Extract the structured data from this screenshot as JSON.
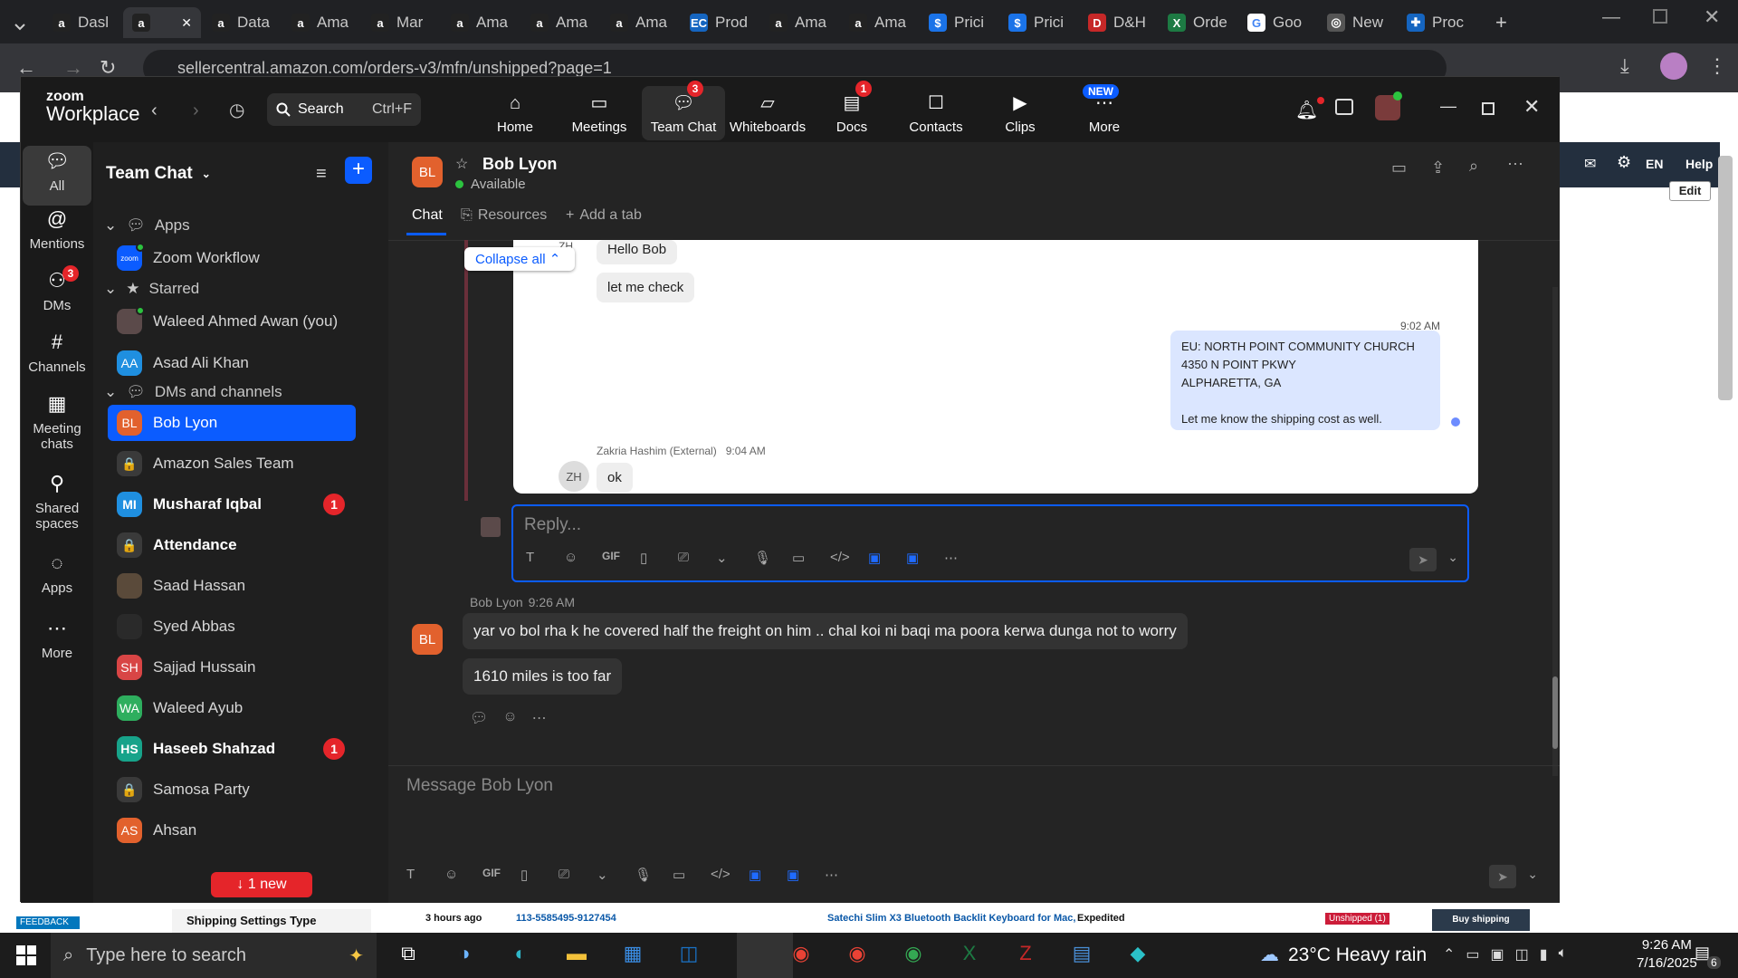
{
  "browser": {
    "tabs": [
      {
        "label": "Dasl",
        "fav": "a",
        "color": "#222"
      },
      {
        "label": "",
        "fav": "a",
        "color": "#222",
        "active": true
      },
      {
        "label": "Data",
        "fav": "a",
        "color": "#222"
      },
      {
        "label": "Ama",
        "fav": "a",
        "color": "#222"
      },
      {
        "label": "Mar",
        "fav": "a",
        "color": "#222"
      },
      {
        "label": "Ama",
        "fav": "a",
        "color": "#222"
      },
      {
        "label": "Ama",
        "fav": "a",
        "color": "#222"
      },
      {
        "label": "Ama",
        "fav": "a",
        "color": "#222"
      },
      {
        "label": "Prod",
        "fav": "EC",
        "color": "#1565c0"
      },
      {
        "label": "Ama",
        "fav": "a",
        "color": "#222"
      },
      {
        "label": "Ama",
        "fav": "a",
        "color": "#222"
      },
      {
        "label": "Prici",
        "fav": "$",
        "color": "#1a73e8"
      },
      {
        "label": "Prici",
        "fav": "$",
        "color": "#1a73e8"
      },
      {
        "label": "D&H",
        "fav": "D",
        "color": "#c62828"
      },
      {
        "label": "Orde",
        "fav": "X",
        "color": "#1d7a43"
      },
      {
        "label": "Goo",
        "fav": "G",
        "color": "#ffffff"
      },
      {
        "label": "New",
        "fav": "◎",
        "color": "#555"
      },
      {
        "label": "Proc",
        "fav": "✚",
        "color": "#1565c0"
      }
    ],
    "url": "sellercentral.amazon.com/orders-v3/mfn/unshipped?page=1"
  },
  "bg_page": {
    "lang": "EN",
    "help": "Help",
    "edit": "Edit",
    "feedback": "FEEDBACK",
    "shipping_settings": "Shipping Settings Type",
    "order_time": "3 hours ago",
    "order_id": "113-5585495-9127454",
    "product": "Satechi Slim X3 Bluetooth Backlit Keyboard for Mac,",
    "shipping": "Expedited",
    "status": "Unshipped (1)",
    "buy_shipping": "Buy shipping"
  },
  "zoom": {
    "brand_top": "zoom",
    "brand_bottom": "Workplace",
    "search_label": "Search",
    "search_shortcut": "Ctrl+F",
    "nav": [
      {
        "label": "Home",
        "icon": "home-icon"
      },
      {
        "label": "Meetings",
        "icon": "video-icon"
      },
      {
        "label": "Team Chat",
        "icon": "chat-icon",
        "badge": "3",
        "active": true
      },
      {
        "label": "Whiteboards",
        "icon": "whiteboard-icon"
      },
      {
        "label": "Docs",
        "icon": "docs-icon",
        "badge": "1"
      },
      {
        "label": "Contacts",
        "icon": "contacts-icon"
      },
      {
        "label": "Clips",
        "icon": "clips-icon"
      },
      {
        "label": "More",
        "icon": "more-icon",
        "tag": "NEW"
      }
    ],
    "rail": [
      {
        "label": "All",
        "icon": "chat-icon"
      },
      {
        "label": "Mentions",
        "icon": "at-icon"
      },
      {
        "label": "DMs",
        "icon": "people-icon",
        "badge": "3"
      },
      {
        "label": "Channels",
        "icon": "hash-icon"
      },
      {
        "label": "Meeting chats",
        "icon": "calendar-icon"
      },
      {
        "label": "Shared spaces",
        "icon": "shared-icon"
      },
      {
        "label": "Apps",
        "icon": "apps-icon"
      },
      {
        "label": "More",
        "icon": "more-icon"
      }
    ],
    "sidebar": {
      "title": "Team Chat",
      "sections": {
        "apps": "Apps",
        "starred": "Starred",
        "dms": "DMs and channels"
      },
      "app_item": "Zoom Workflow",
      "starred": [
        "Waleed Ahmed Awan (you)",
        "Asad Ali Khan"
      ],
      "items": [
        {
          "name": "Bob Lyon",
          "initials": "BL",
          "color": "#e2612d",
          "selected": true
        },
        {
          "name": "Amazon Sales Team",
          "initials": "🔒",
          "color": "#3a3a3a"
        },
        {
          "name": "Musharaf Iqbal",
          "initials": "MI",
          "color": "#1f8fe0",
          "bold": true,
          "count": "1"
        },
        {
          "name": "Attendance",
          "initials": "🔒",
          "color": "#3a3a3a",
          "bold": true
        },
        {
          "name": "Saad Hassan",
          "initials": "",
          "color": "#5a4a3a"
        },
        {
          "name": "Syed Abbas",
          "initials": "",
          "color": "#2a2a2a"
        },
        {
          "name": "Sajjad Hussain",
          "initials": "SH",
          "color": "#d84545"
        },
        {
          "name": "Waleed Ayub",
          "initials": "WA",
          "color": "#2eae5e"
        },
        {
          "name": "Haseeb Shahzad",
          "initials": "HS",
          "color": "#17a38a",
          "bold": true,
          "count": "1"
        },
        {
          "name": "Samosa Party",
          "initials": "🔒",
          "color": "#3a3a3a"
        },
        {
          "name": "Ahsan",
          "initials": "AS",
          "color": "#e2612d"
        }
      ],
      "new_pill": "1 new"
    },
    "chat": {
      "contact_initials": "BL",
      "contact_name": "Bob Lyon",
      "presence": "Available",
      "tabs": [
        "Chat",
        "Resources",
        "Add a tab"
      ],
      "collapse_all": "Collapse all",
      "thread": {
        "msg_hello": "Hello Bob",
        "msg_check": "let me check",
        "zh": "ZH",
        "time_sent": "9:02 AM",
        "sent_lines": [
          "EU: NORTH POINT COMMUNITY CHURCH",
          "4350 N POINT PKWY",
          "ALPHARETTA, GA",
          "",
          "Let me know the shipping cost as well."
        ],
        "reply_sender": "Zakria Hashim (External)",
        "reply_time": "9:04 AM",
        "reply_text": "ok",
        "reply_placeholder": "Reply..."
      },
      "msg_sender": "Bob Lyon",
      "msg_time": "9:26 AM",
      "msg1": "yar vo bol rha k he covered half the freight on him .. chal koi ni baqi ma poora kerwa dunga not to worry",
      "msg2": "1610 miles is too far",
      "composer_placeholder": "Message Bob Lyon",
      "gif": "GIF"
    }
  },
  "taskbar": {
    "search_placeholder": "Type here to search",
    "weather": "23°C  Heavy rain",
    "time": "9:26 AM",
    "date": "7/16/2025",
    "notif_count": "6"
  }
}
